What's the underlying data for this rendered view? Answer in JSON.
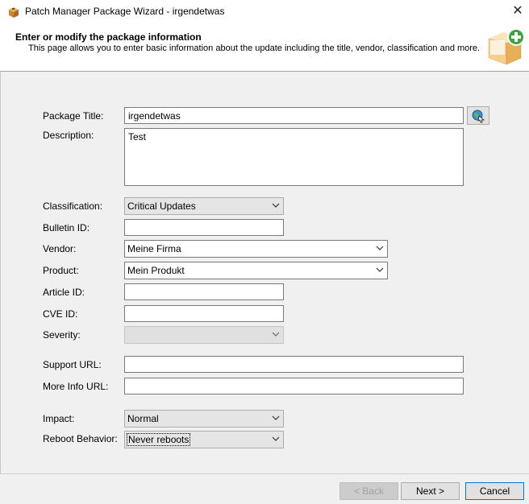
{
  "window": {
    "title": "Patch Manager Package Wizard - irgendetwas",
    "close_symbol": "✕"
  },
  "header": {
    "title": "Enter or modify the package information",
    "subtitle": "This page allows you to enter basic information about the update including the title, vendor, classification and more."
  },
  "form": {
    "package_title": {
      "label": "Package Title:",
      "value": "irgendetwas"
    },
    "description": {
      "label": "Description:",
      "value": "Test"
    },
    "classification": {
      "label": "Classification:",
      "value": "Critical Updates"
    },
    "bulletin_id": {
      "label": "Bulletin ID:",
      "value": ""
    },
    "vendor": {
      "label": "Vendor:",
      "value": "Meine Firma"
    },
    "product": {
      "label": "Product:",
      "value": "Mein Produkt"
    },
    "article_id": {
      "label": "Article ID:",
      "value": ""
    },
    "cve_id": {
      "label": "CVE ID:",
      "value": ""
    },
    "severity": {
      "label": "Severity:",
      "value": ""
    },
    "support_url": {
      "label": "Support URL:",
      "value": ""
    },
    "more_info_url": {
      "label": "More Info URL:",
      "value": ""
    },
    "impact": {
      "label": "Impact:",
      "value": "Normal"
    },
    "reboot_behavior": {
      "label": "Reboot Behavior:",
      "value": "Never reboots"
    }
  },
  "buttons": {
    "back": "< Back",
    "next": "Next >",
    "cancel": "Cancel"
  },
  "icons": {
    "app": "package-icon",
    "header": "add-package-icon",
    "lookup": "globe-lookup-icon"
  }
}
